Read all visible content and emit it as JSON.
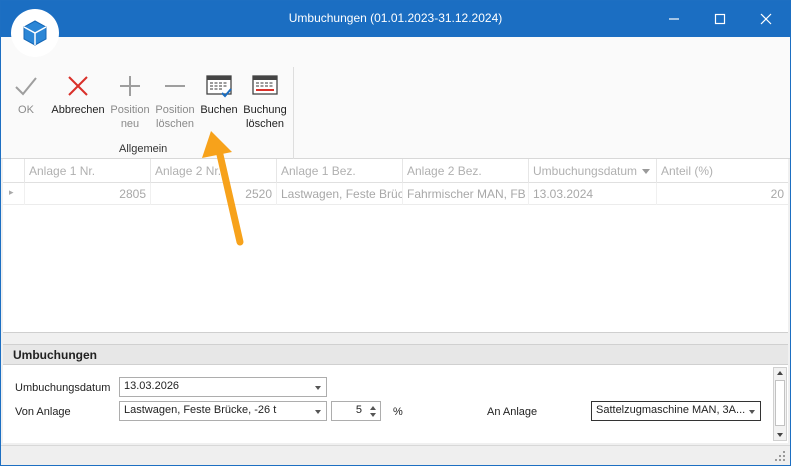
{
  "window": {
    "title": "Umbuchungen (01.01.2023-31.12.2024)"
  },
  "ribbon": {
    "buttons": [
      {
        "label": "OK",
        "icon": "check-icon"
      },
      {
        "label": "Abbrechen",
        "icon": "x-icon"
      },
      {
        "label1": "Position",
        "label2": "neu",
        "icon": "plus-icon"
      },
      {
        "label1": "Position",
        "label2": "löschen",
        "icon": "minus-icon"
      },
      {
        "label": "Buchen",
        "icon": "table-check-icon"
      },
      {
        "label1": "Buchung",
        "label2": "löschen",
        "icon": "table-delete-icon"
      }
    ],
    "group_label": "Allgemein"
  },
  "grid": {
    "columns": [
      "Anlage 1 Nr.",
      "Anlage 2 Nr.",
      "Anlage 1 Bez.",
      "Anlage 2 Bez.",
      "Umbuchungsdatum",
      "Anteil (%)"
    ],
    "row": [
      "2805",
      "2520",
      "Lastwagen, Feste Brücke...",
      "Fahrmischer MAN, FB ...",
      "13.03.2024",
      "20"
    ]
  },
  "panel": {
    "title": "Umbuchungen",
    "date_label": "Umbuchungsdatum",
    "date_value": "13.03.2026",
    "von_label": "Von Anlage",
    "von_value": "Lastwagen, Feste Brücke, -26 t",
    "percent_value": "5",
    "percent_unit": "%",
    "an_label": "An Anlage",
    "an_value": "Sattelzugmaschine MAN, 3A..."
  },
  "colors": {
    "titlebar": "#1b6ec2",
    "arrow": "#f7a21b",
    "cancel_red": "#d9302a"
  }
}
